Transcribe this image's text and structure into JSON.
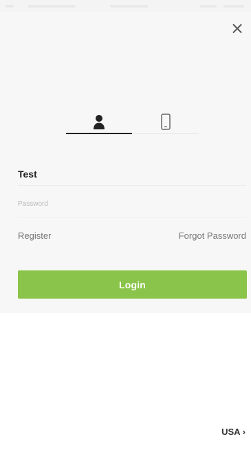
{
  "header": {
    "close_label": "×"
  },
  "tabs": [
    {
      "icon": "user-icon"
    },
    {
      "icon": "phone-icon"
    }
  ],
  "form": {
    "username_value": "Test",
    "password_placeholder": "Password"
  },
  "links": {
    "register": "Register",
    "forgot_password": "Forgot Password"
  },
  "actions": {
    "login_label": "Login"
  },
  "footer": {
    "region_label": "USA ›"
  },
  "colors": {
    "accent": "#8bc44a",
    "background": "#f7f7f7",
    "text": "#222222"
  }
}
